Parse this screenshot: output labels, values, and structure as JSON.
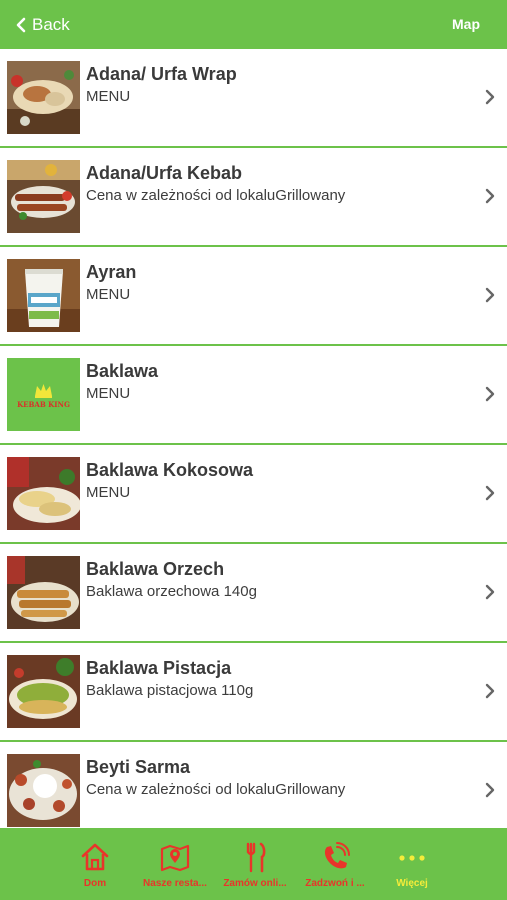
{
  "nav": {
    "back_label": "Back",
    "map_label": "Map"
  },
  "items": [
    {
      "title": "Adana/ Urfa Wrap",
      "subtitle": "MENU"
    },
    {
      "title": "Adana/Urfa Kebab",
      "subtitle": "Cena w zależności od lokaluGrillowany"
    },
    {
      "title": "Ayran",
      "subtitle": "MENU"
    },
    {
      "title": "Baklawa",
      "subtitle": "MENU",
      "logo_text": "KEBAB KING"
    },
    {
      "title": "Baklawa Kokosowa",
      "subtitle": "MENU"
    },
    {
      "title": "Baklawa Orzech",
      "subtitle": "Baklawa orzechowa 140g"
    },
    {
      "title": "Baklawa Pistacja",
      "subtitle": "Baklawa pistacjowa 110g"
    },
    {
      "title": "Beyti Sarma",
      "subtitle": "Cena w zależności od lokaluGrillowany"
    }
  ],
  "tabs": [
    {
      "label": "Dom",
      "icon": "home-icon"
    },
    {
      "label": "Nasze resta...",
      "icon": "map-pin-icon"
    },
    {
      "label": "Zamów onli...",
      "icon": "fork-knife-icon"
    },
    {
      "label": "Zadzwoń i ...",
      "icon": "phone-icon"
    },
    {
      "label": "Więcej",
      "icon": "more-dots-icon"
    }
  ],
  "colors": {
    "accent": "#6cc24a",
    "tab_label": "#e8352a",
    "tab_active": "#f4ec3a"
  }
}
